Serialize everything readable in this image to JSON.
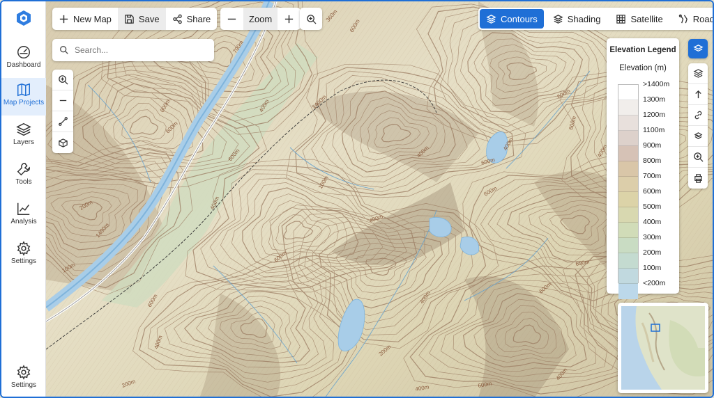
{
  "sidebar": {
    "items": [
      {
        "label": "Dashboard",
        "icon": "dashboard-icon"
      },
      {
        "label": "Map Projects",
        "icon": "map-icon",
        "active": true
      },
      {
        "label": "Layers",
        "icon": "layers-icon"
      },
      {
        "label": "Tools",
        "icon": "wrench-icon"
      },
      {
        "label": "Analysis",
        "icon": "chart-icon"
      },
      {
        "label": "Settings",
        "icon": "gear-icon"
      }
    ],
    "footer": {
      "label": "Settings",
      "icon": "gear-icon"
    }
  },
  "toolbar": {
    "new_map_label": "New Map",
    "save_label": "Save",
    "share_label": "Share",
    "zoom_label": "Zoom"
  },
  "layers": {
    "contours_label": "Contours",
    "shading_label": "Shading",
    "satellite_label": "Satellite",
    "roads_label": "Roads",
    "active": "contours"
  },
  "search": {
    "placeholder": "Search..."
  },
  "legend": {
    "title": "Elevation Legend",
    "subtitle": "Elevation (m)",
    "entries": [
      ">1400m",
      "1300m",
      "1200m",
      "1100m",
      "900m",
      "800m",
      "700m",
      "600m",
      "500m",
      "400m",
      "300m",
      "200m",
      "100m",
      "<200m"
    ],
    "colors": [
      "#ffffff",
      "#f1eeeb",
      "#e8e0dc",
      "#ddd1cb",
      "#d6c2b6",
      "#d9c6a8",
      "#dcceaa",
      "#dcd3a8",
      "#d8d8b0",
      "#d1dcb8",
      "#c9dcc3",
      "#c4dbd0",
      "#c1d9df",
      "#bcd8ea"
    ]
  },
  "map": {
    "contour_labels": [
      "360m",
      "600m",
      "700m",
      "400m",
      "1400m",
      "600m",
      "600m",
      "100m",
      "200m",
      "1400m",
      "400m",
      "600m",
      "600m",
      "400m",
      "400m",
      "600m",
      "600m",
      "400m",
      "600m",
      "600m",
      "400m",
      "400m",
      "600m",
      "400m",
      "600m",
      "100m",
      "600m",
      "400m",
      "200m",
      "400m",
      "200m",
      "600m",
      "400m",
      "400m"
    ],
    "colors": {
      "water": "#a8cde8",
      "river": "#7fb4dc",
      "contour": "#9a7a60",
      "accent": "#1f6fd6"
    }
  }
}
